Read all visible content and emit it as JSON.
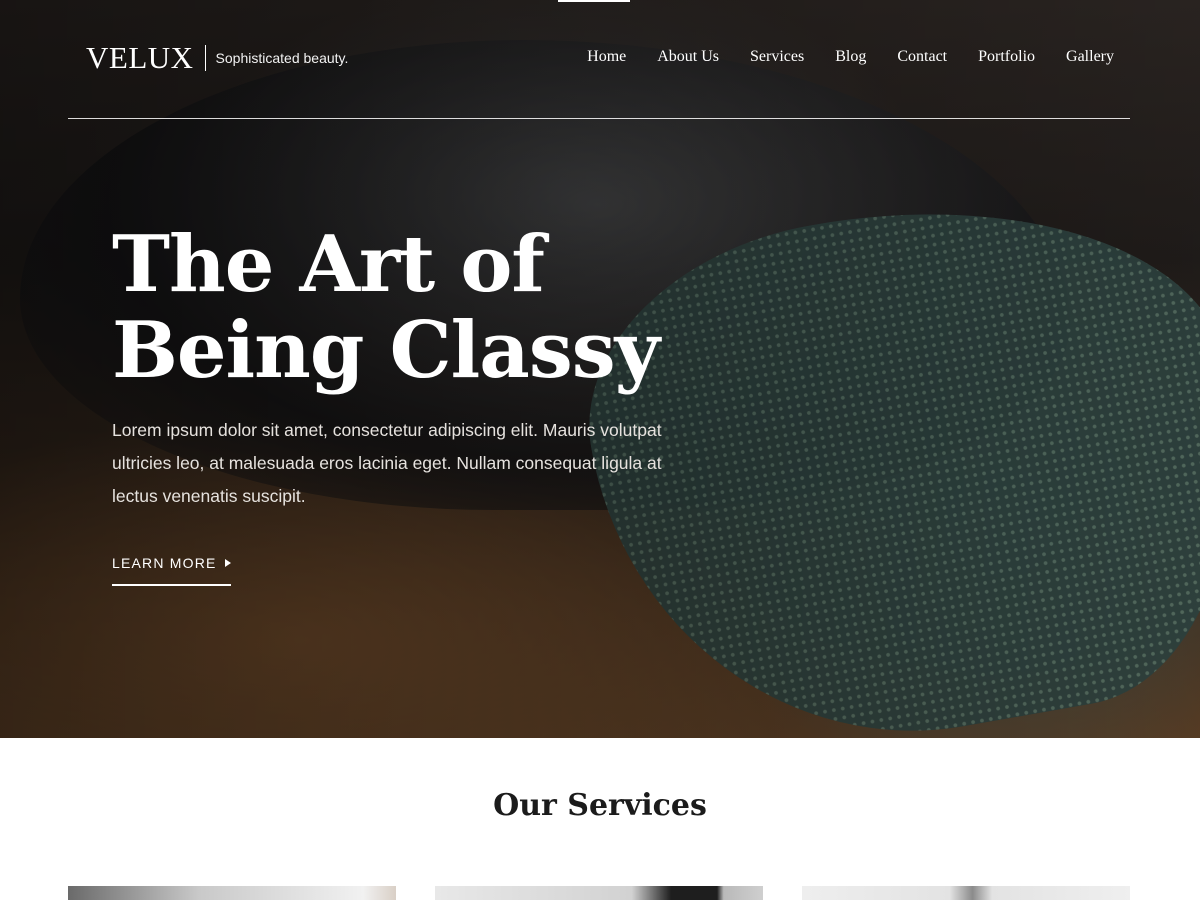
{
  "header": {
    "logo": "VELUX",
    "tagline": "Sophisticated beauty.",
    "nav": [
      {
        "label": "Home"
      },
      {
        "label": "About Us"
      },
      {
        "label": "Services"
      },
      {
        "label": "Blog"
      },
      {
        "label": "Contact"
      },
      {
        "label": "Portfolio"
      },
      {
        "label": "Gallery"
      }
    ]
  },
  "hero": {
    "headline_line1": "The Art of",
    "headline_line2": "Being Classy",
    "text": "Lorem ipsum dolor sit amet, consectetur adipiscing elit. Mauris volutpat ultricies leo, at malesuada eros lacinia eget. Nullam consequat ligula at lectus venenatis suscipit.",
    "cta_label": "LEARN MORE",
    "cta_icon": "arrow-right-icon"
  },
  "services": {
    "title": "Our Services"
  },
  "colors": {
    "hero_text": "#ffffff",
    "body_text": "#1b1b1b",
    "background": "#ffffff"
  }
}
